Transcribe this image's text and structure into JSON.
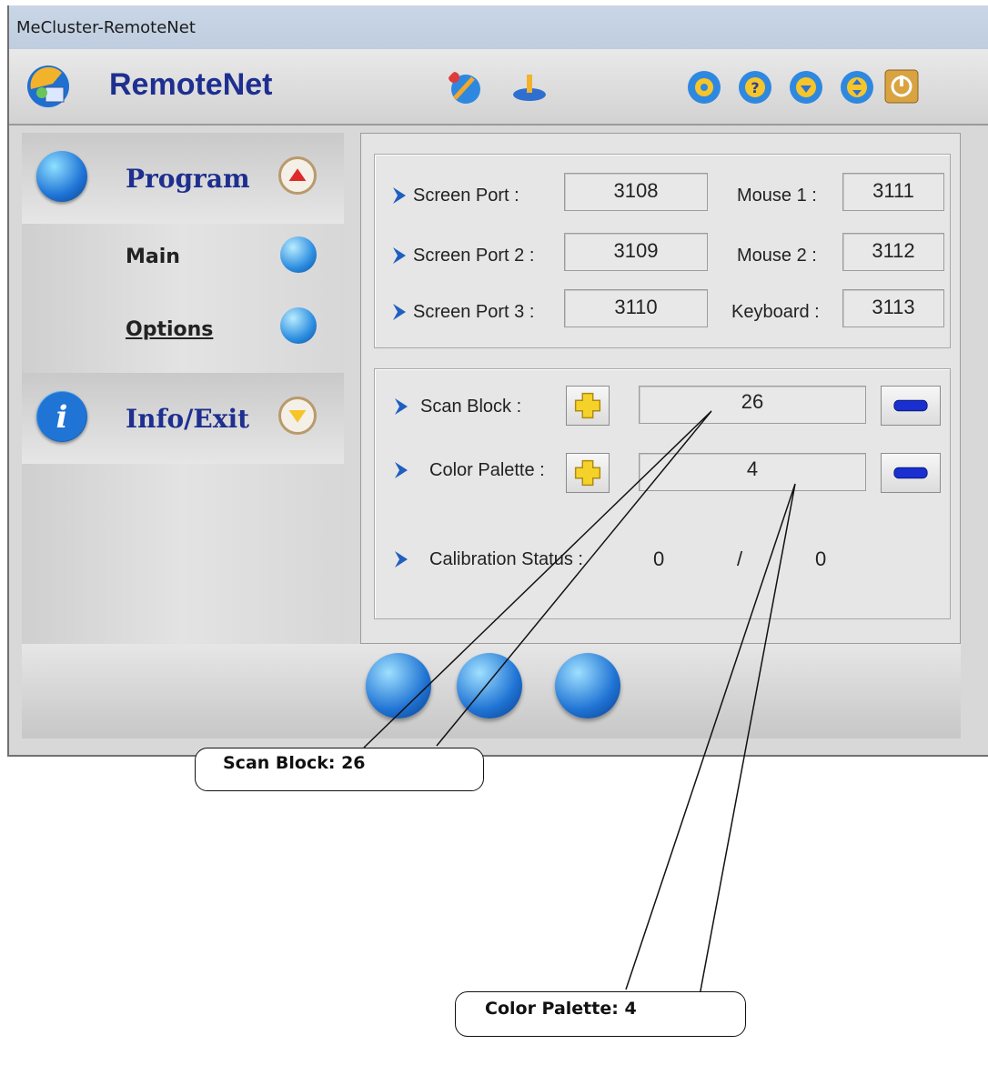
{
  "window": {
    "title": "MeCluster-RemoteNet"
  },
  "app": {
    "name": "RemoteNet"
  },
  "toolbar": {
    "icons": [
      "connect-wizard-icon",
      "network-icon",
      "settings-icon",
      "help-icon",
      "download-icon",
      "sort-icon",
      "power-icon"
    ]
  },
  "sidebar": {
    "program": {
      "label": "Program",
      "items": [
        {
          "label": "Main"
        },
        {
          "label": "Options"
        }
      ]
    },
    "info": {
      "label": "Info/Exit"
    }
  },
  "ports": {
    "screen_port_label": "Screen Port :",
    "screen_port_value": "3108",
    "screen_port2_label": "Screen Port 2 :",
    "screen_port2_value": "3109",
    "screen_port3_label": "Screen Port 3 :",
    "screen_port3_value": "3110",
    "mouse1_label": "Mouse 1 :",
    "mouse1_value": "3111",
    "mouse2_label": "Mouse 2 :",
    "mouse2_value": "3112",
    "keyboard_label": "Keyboard :",
    "keyboard_value": "3113"
  },
  "settings": {
    "scan_block_label": "Scan Block :",
    "scan_block_value": "26",
    "color_palette_label": "Color Palette :",
    "color_palette_value": "4",
    "calibration_label": "Calibration Status :",
    "calibration_a": "0",
    "calibration_sep": "/",
    "calibration_b": "0"
  },
  "callouts": {
    "scan_block": "Scan Block: 26",
    "color_palette": "Color Palette: 4"
  },
  "colors": {
    "accent": "#1e2f8f",
    "panel": "#e4e4e4",
    "titlebar": "#c9d6e6"
  }
}
